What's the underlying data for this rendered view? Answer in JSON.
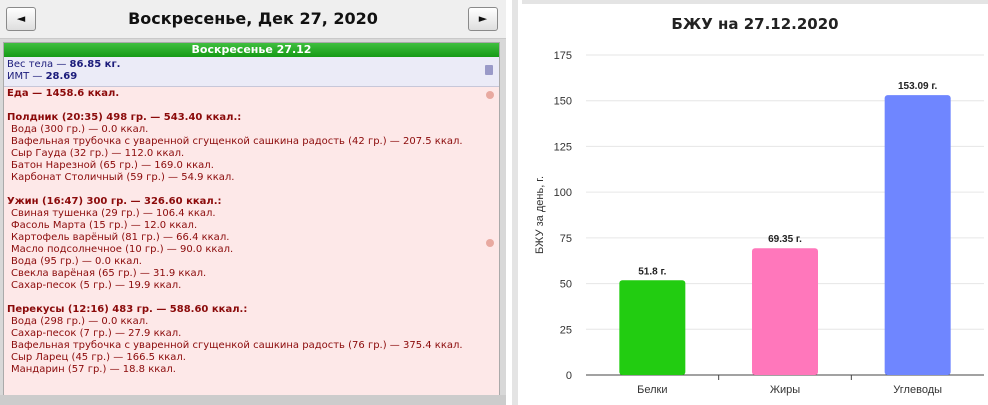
{
  "header": {
    "prev_label": "◄",
    "next_label": "►",
    "date_title": "Воскресенье, Дек 27, 2020"
  },
  "day_bar": "Воскресенье 27.12",
  "body": {
    "weight_prefix": "Вес тела — ",
    "weight_value": "86.85 кг.",
    "bmi_prefix": "ИМТ — ",
    "bmi_value": "28.69"
  },
  "food_total": "Еда — 1458.6 ккал.",
  "meals": [
    {
      "title": "Полдник (20:35) 498 гр. — 543.40 ккал.:",
      "items": [
        "Вода (300 гр.) — 0.0 ккал.",
        "Вафельная трубочка с уваренной сгущенкой сашкина радость (42 гр.) — 207.5 ккал.",
        "Сыр Гауда (32 гр.) — 112.0 ккал.",
        "Батон Нарезной (65 гр.) — 169.0 ккал.",
        "Карбонат Столичный (59 гр.) — 54.9 ккал."
      ]
    },
    {
      "title": "Ужин (16:47) 300 гр. — 326.60 ккал.:",
      "items": [
        "Свиная тушенка (29 гр.) — 106.4 ккал.",
        "Фасоль Марта (15 гр.) — 12.0 ккал.",
        "Картофель варёный (81 гр.) — 66.4 ккал.",
        "Масло подсолнечное (10 гр.) — 90.0 ккал.",
        "Вода (95 гр.) — 0.0 ккал.",
        "Свекла варёная (65 гр.) — 31.9 ккал.",
        "Сахар-песок (5 гр.) — 19.9 ккал."
      ]
    },
    {
      "title": "Перекусы (12:16) 483 гр. — 588.60 ккал.:",
      "items": [
        "Вода (298 гр.) — 0.0 ккал.",
        "Сахар-песок (7 гр.) — 27.9 ккал.",
        "Вафельная трубочка с уваренной сгущенкой сашкина радость (76 гр.) — 375.4 ккал.",
        "Сыр Ларец (45 гр.) — 166.5 ккал.",
        "Мандарин (57 гр.) — 18.8 ккал."
      ]
    }
  ],
  "chart_data": {
    "type": "bar",
    "title": "БЖУ на 27.12.2020",
    "ylabel": "БЖУ за день, г.",
    "xlabel": "",
    "ylim": [
      0,
      175
    ],
    "yticks": [
      0,
      25,
      50,
      75,
      100,
      125,
      150,
      175
    ],
    "grid": true,
    "categories": [
      "Белки",
      "Жиры",
      "Углеводы"
    ],
    "values": [
      51.8,
      69.35,
      153.09
    ],
    "value_labels": [
      "51.8 г.",
      "69.35 г.",
      "153.09 г."
    ],
    "colors": [
      "#22cc11",
      "#ff77bb",
      "#6f86ff"
    ]
  }
}
